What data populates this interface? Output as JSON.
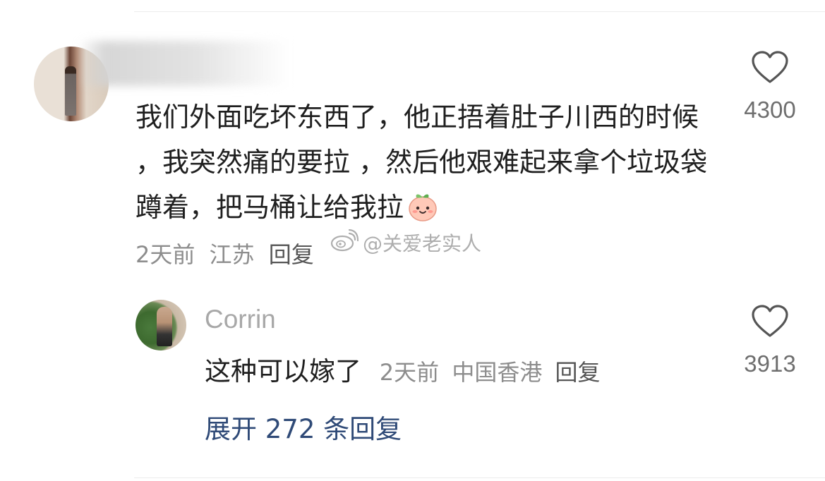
{
  "comment": {
    "text": "我们外面吃坏东西了，他正捂着肚子川西的时候 ，我突然痛的要拉 ，然后他艰难起来拿个垃圾袋蹲着，把马桶让给我拉",
    "emoji": "peach-face",
    "time": "2天前",
    "location": "江苏",
    "reply_label": "回复",
    "likes": "4300"
  },
  "watermark": {
    "text": "@关爱老实人"
  },
  "reply": {
    "username": "Corrin",
    "text": "这种可以嫁了",
    "time": "2天前",
    "location": "中国香港",
    "reply_label": "回复",
    "likes": "3913"
  },
  "expand": {
    "label": "展开 272 条回复"
  },
  "colors": {
    "accent_link": "#2f4a77",
    "meta_gray": "#8d8d8d",
    "text_dark": "#1f1f1f"
  }
}
